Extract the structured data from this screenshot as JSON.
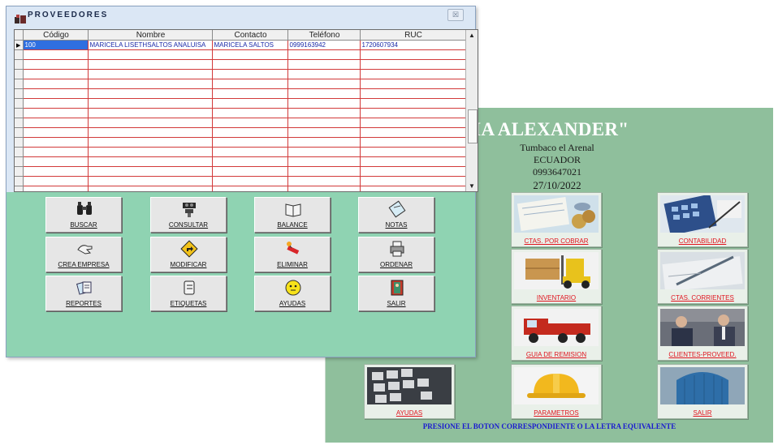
{
  "main_window": {
    "title": "SA \"PESCADERIA ALEXANDER\"",
    "address_lines": [
      "Tumbaco el Arenal",
      "ECUADOR",
      "0993647021",
      "27/10/2022"
    ],
    "tiles": [
      {
        "label": "CTAS. POR COBRAR",
        "icon": "calculator-coins-icon"
      },
      {
        "label": "CONTABILIDAD",
        "icon": "calculator-icon"
      },
      {
        "label": "INVENTARIO",
        "icon": "forklift-icon"
      },
      {
        "label": "CTAS. CORRIENTES",
        "icon": "pen-document-icon"
      },
      {
        "label": "GUIA DE REMISION",
        "icon": "truck-icon"
      },
      {
        "label": "CLIENTES-PROVEED.",
        "icon": "business-people-icon"
      },
      {
        "label": "AYUDAS",
        "icon": "keyboard-icon"
      },
      {
        "label": "PARAMETROS",
        "icon": "hard-hat-icon"
      },
      {
        "label": "SALIR",
        "icon": "door-icon"
      }
    ],
    "footer": "PRESIONE EL BOTON CORRESPONDIENTE O LA LETRA EQUIVALENTE"
  },
  "dialog": {
    "title": "PROVEEDORES",
    "close_label": "☒",
    "grid": {
      "columns": [
        "Código",
        "Nombre",
        "Contacto",
        "Teléfono",
        "RUC"
      ],
      "rows": [
        [
          "100",
          "MARICELA LISETHSALTOS ANALUISA",
          "MARICELA SALTOS",
          "0999163942",
          "1720607934"
        ]
      ],
      "selected_marker": "▶"
    },
    "buttons": [
      {
        "label": "BUSCAR",
        "icon": "binoculars-icon"
      },
      {
        "label": "CONSULTAR",
        "icon": "projector-icon"
      },
      {
        "label": "BALANCE",
        "icon": "book-icon"
      },
      {
        "label": "NOTAS",
        "icon": "note-icon"
      },
      {
        "label": "CREA EMPRESA",
        "icon": "hand-icon"
      },
      {
        "label": "MODIFICAR",
        "icon": "turn-sign-icon"
      },
      {
        "label": "ELIMINAR",
        "icon": "dynamite-icon"
      },
      {
        "label": "ORDENAR",
        "icon": "printer-icon"
      },
      {
        "label": "REPORTES",
        "icon": "reports-icon"
      },
      {
        "label": "ETIQUETAS",
        "icon": "labels-icon"
      },
      {
        "label": "AYUDAS",
        "icon": "smiley-icon"
      },
      {
        "label": "SALIR",
        "icon": "exit-door-icon"
      }
    ]
  }
}
